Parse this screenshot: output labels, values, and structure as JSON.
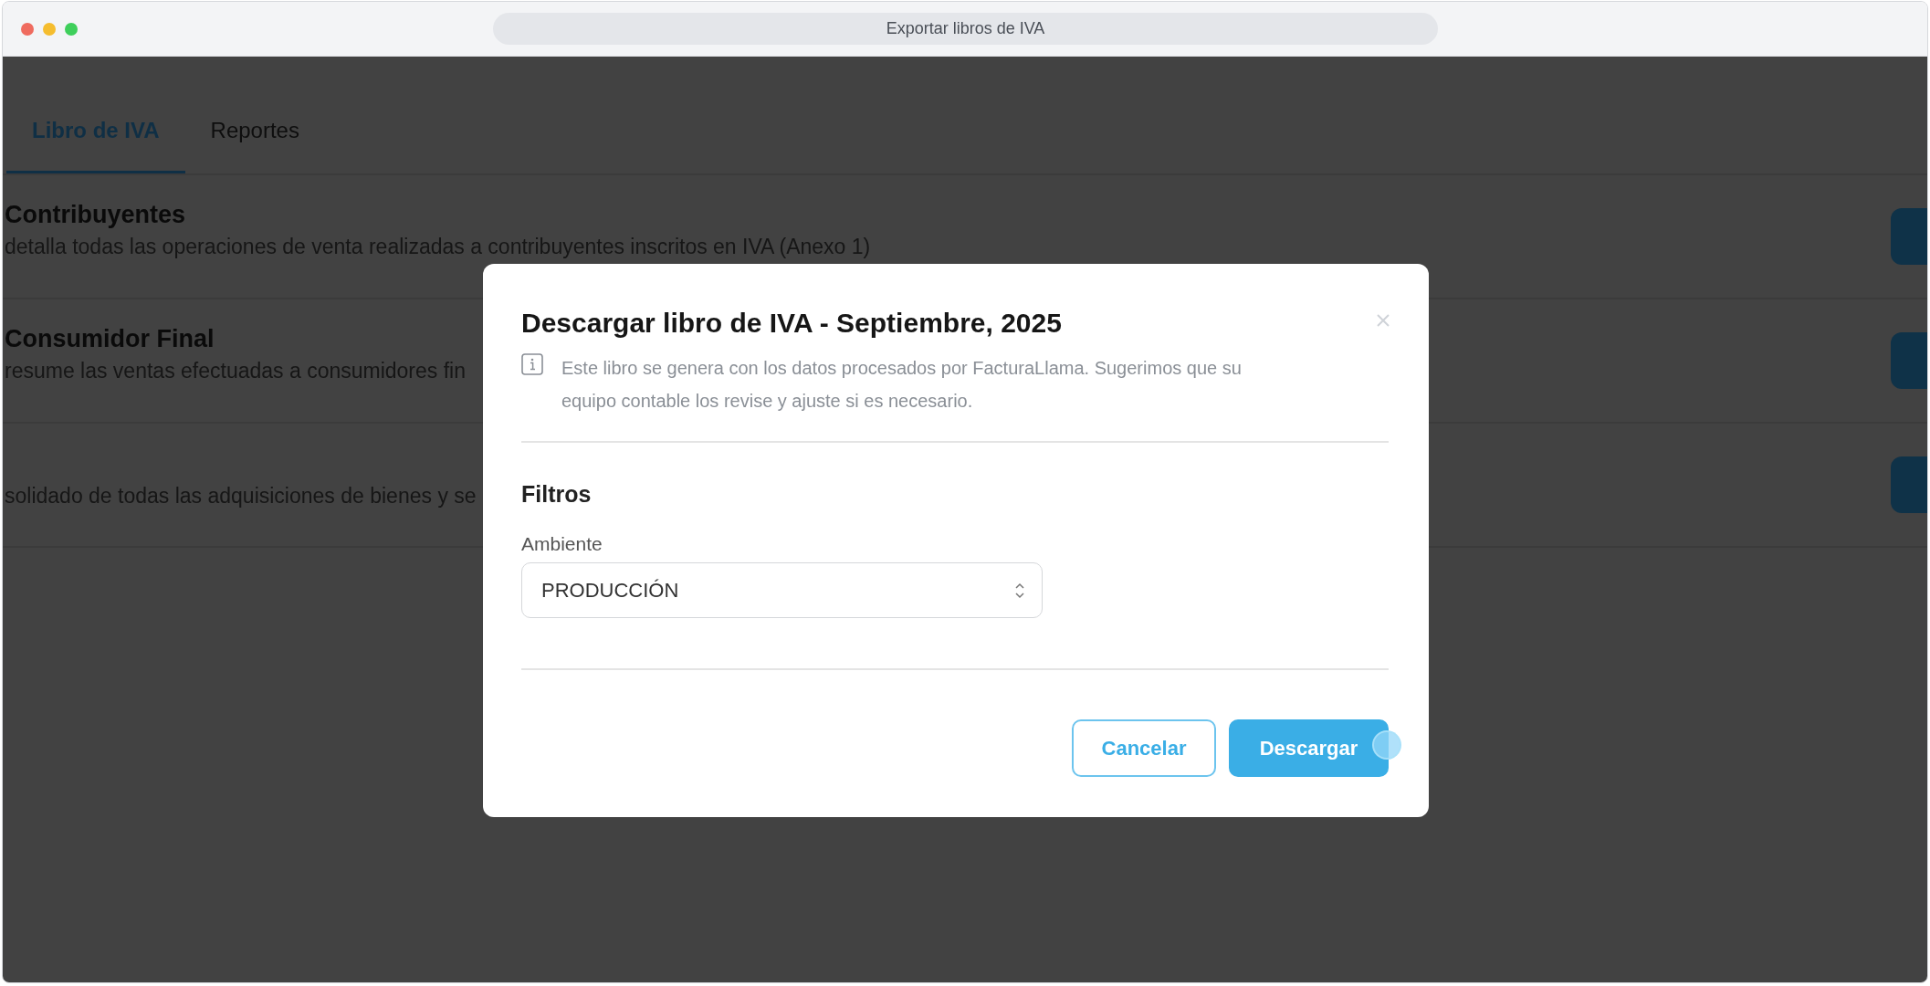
{
  "window": {
    "title": "Exportar libros de IVA"
  },
  "tabs": [
    {
      "label": "Libro de IVA",
      "selected": true
    },
    {
      "label": "Reportes",
      "selected": false
    }
  ],
  "rows": [
    {
      "title": "Contribuyentes",
      "description": "detalla todas las operaciones de venta realizadas a contribuyentes inscritos en IVA (Anexo 1)"
    },
    {
      "title": "Consumidor Final",
      "description": "resume las ventas efectuadas a consumidores fin"
    },
    {
      "description": "solidado de todas las adquisiciones de bienes y se"
    }
  ],
  "dialog": {
    "title": "Descargar libro de IVA - Septiembre, 2025",
    "info": "Este libro se genera con los datos procesados por FacturaLlama. Sugerimos que su equipo contable los revise y ajuste si es necesario.",
    "section": "Filtros",
    "field": {
      "label": "Ambiente",
      "value": "PRODUCCIÓN"
    },
    "buttons": [
      {
        "label": "Cancelar",
        "kind": "secondary"
      },
      {
        "label": "Descargar",
        "kind": "primary"
      }
    ]
  }
}
